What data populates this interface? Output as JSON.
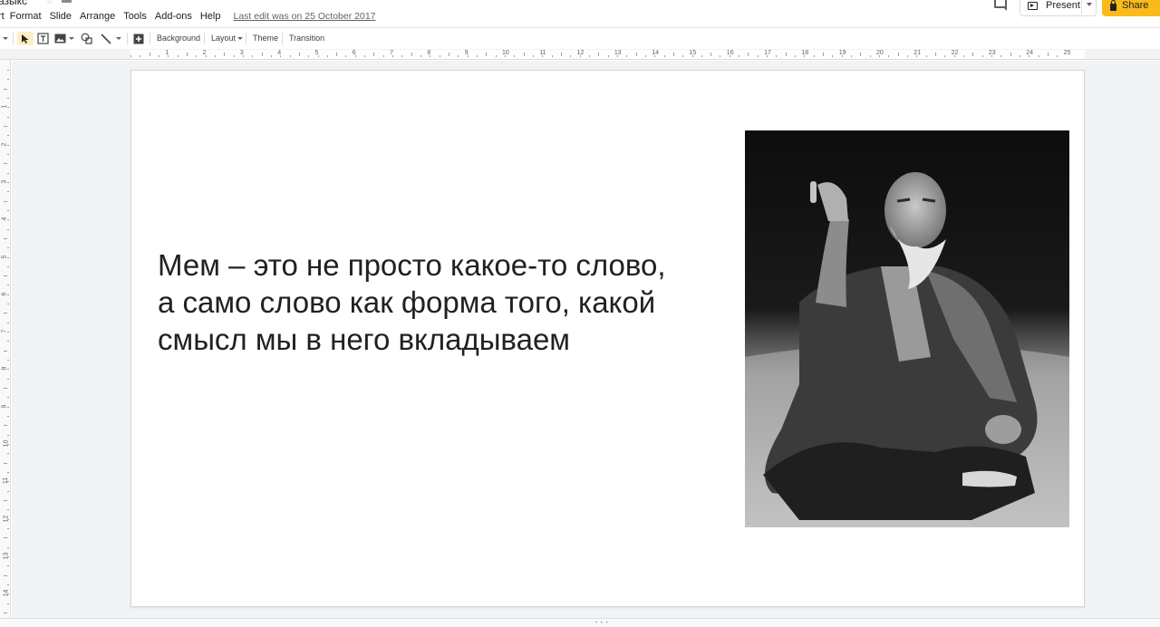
{
  "document": {
    "title": "азыкс"
  },
  "menu": {
    "items": [
      "rt",
      "Format",
      "Slide",
      "Arrange",
      "Tools",
      "Add-ons",
      "Help"
    ],
    "last_edit": "Last edit was on 25 October 2017"
  },
  "header": {
    "present_label": "Present",
    "share_label": "Share",
    "share_color": "#f9ba1a"
  },
  "toolbar": {
    "background_label": "Background",
    "layout_label": "Layout",
    "theme_label": "Theme",
    "transition_label": "Transition"
  },
  "ruler": {
    "h_labels": [
      "1",
      "2",
      "3",
      "4",
      "5",
      "6",
      "7",
      "8",
      "9",
      "10",
      "11",
      "12",
      "13",
      "14",
      "15",
      "16",
      "17",
      "18",
      "19",
      "20",
      "21",
      "22",
      "23",
      "24",
      "25"
    ],
    "v_labels": [
      "1",
      "2",
      "3",
      "4",
      "5",
      "6",
      "7",
      "8",
      "9",
      "10",
      "11",
      "12",
      "13",
      "14"
    ]
  },
  "slide": {
    "text_line1": "Мем – это не просто какое-то слово,",
    "text_line2": "а само слово как форма того, какой",
    "text_line3": "смысл мы в него вкладываем"
  },
  "icons": {
    "comment": "comment-icon",
    "present": "present-icon",
    "share": "lock-icon",
    "select": "cursor-icon",
    "textbox": "textbox-icon",
    "image": "image-icon",
    "shape": "shape-icon",
    "line": "line-icon",
    "new_slide": "add-comment-icon"
  }
}
